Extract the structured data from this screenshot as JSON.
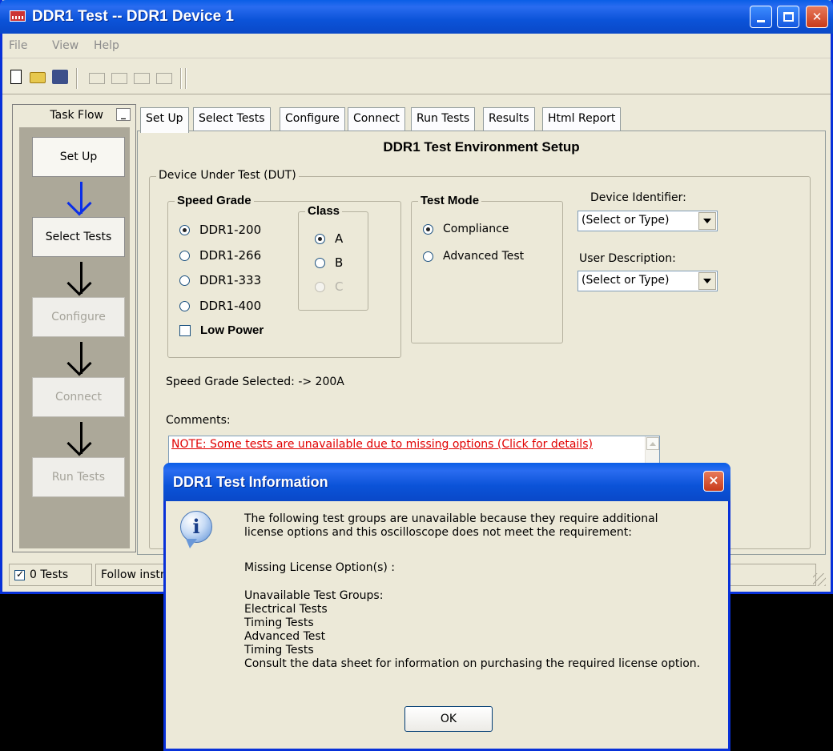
{
  "window": {
    "title": "DDR1 Test -- DDR1 Device 1",
    "menu": [
      "File",
      "View",
      "Help"
    ],
    "toolbar_icons": [
      "new-file-icon",
      "open-folder-icon",
      "save-icon",
      "toolbar-icon-1",
      "toolbar-icon-2",
      "toolbar-icon-3",
      "toolbar-icon-4"
    ]
  },
  "taskflow": {
    "header": "Task Flow",
    "minimize": "_",
    "steps": [
      {
        "label": "Set Up",
        "enabled": true
      },
      {
        "label": "Select Tests",
        "enabled": true
      },
      {
        "label": "Configure",
        "enabled": false
      },
      {
        "label": "Connect",
        "enabled": false
      },
      {
        "label": "Run Tests",
        "enabled": false
      }
    ]
  },
  "tabs": [
    "Set Up",
    "Select Tests",
    "Configure",
    "Connect",
    "Run Tests",
    "Results",
    "Html Report"
  ],
  "setup": {
    "title": "DDR1 Test Environment Setup",
    "dut_group": "Device Under Test (DUT)",
    "speed_grade": {
      "label": "Speed Grade",
      "options": [
        "DDR1-200",
        "DDR1-266",
        "DDR1-333",
        "DDR1-400"
      ],
      "selected": "DDR1-200"
    },
    "class": {
      "label": "Class",
      "options": [
        "A",
        "B",
        "C"
      ],
      "selected": "A"
    },
    "low_power": {
      "label": "Low Power",
      "checked": false
    },
    "test_mode": {
      "label": "Test Mode",
      "options": [
        "Compliance",
        "Advanced Test"
      ],
      "selected": "Compliance"
    },
    "device_identifier": {
      "label": "Device Identifier:",
      "value": "(Select or Type)"
    },
    "user_description": {
      "label": "User Description:",
      "value": "(Select or Type)"
    },
    "speed_grade_selected": "Speed Grade Selected: -> 200A",
    "comments_label": "Comments:",
    "comments_note": "NOTE:  Some tests are unavailable due to missing options (Click for details)"
  },
  "statusbar": {
    "tests": "0 Tests",
    "message": "Follow instructions"
  },
  "dialog": {
    "title": "DDR1 Test Information",
    "close": "×",
    "intro_lines": [
      "The following test groups are unavailable because they require additional",
      "license options and this oscilloscope does not meet the requirement:"
    ],
    "missing_label": "Missing License Option(s) :",
    "groups_lines": [
      "Unavailable Test Groups:",
      "Electrical Tests",
      "Timing Tests",
      "Advanced Test",
      "Timing Tests",
      "Consult the data sheet for information on purchasing the required license option."
    ],
    "ok_label": "OK"
  }
}
